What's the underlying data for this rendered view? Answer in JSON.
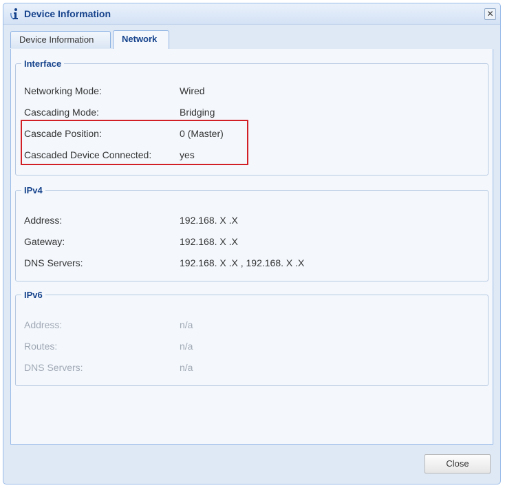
{
  "window": {
    "title": "Device Information",
    "close_symbol": "✕"
  },
  "tabs": [
    {
      "label": "Device Information",
      "active": false
    },
    {
      "label": "Network",
      "active": true
    }
  ],
  "interface": {
    "legend": "Interface",
    "rows": [
      {
        "label": "Networking Mode:",
        "value": "Wired"
      },
      {
        "label": "Cascading Mode:",
        "value": "Bridging"
      },
      {
        "label": "Cascade Position:",
        "value": "0 (Master)"
      },
      {
        "label": "Cascaded Device Connected:",
        "value": "yes"
      }
    ]
  },
  "ipv4": {
    "legend": "IPv4",
    "rows": [
      {
        "label": "Address:",
        "value": "192.168. X .X"
      },
      {
        "label": "Gateway:",
        "value": "192.168. X .X"
      },
      {
        "label": "DNS Servers:",
        "value": "192.168. X .X , 192.168. X .X"
      }
    ]
  },
  "ipv6": {
    "legend": "IPv6",
    "rows": [
      {
        "label": "Address:",
        "value": "n/a"
      },
      {
        "label": "Routes:",
        "value": "n/a"
      },
      {
        "label": "DNS Servers:",
        "value": "n/a"
      }
    ]
  },
  "footer": {
    "close_label": "Close"
  },
  "colors": {
    "highlight_border": "#d21f26",
    "title_text": "#15428b",
    "disabled_text": "#a0a8b4"
  },
  "icons": {
    "title": "info-icon"
  }
}
